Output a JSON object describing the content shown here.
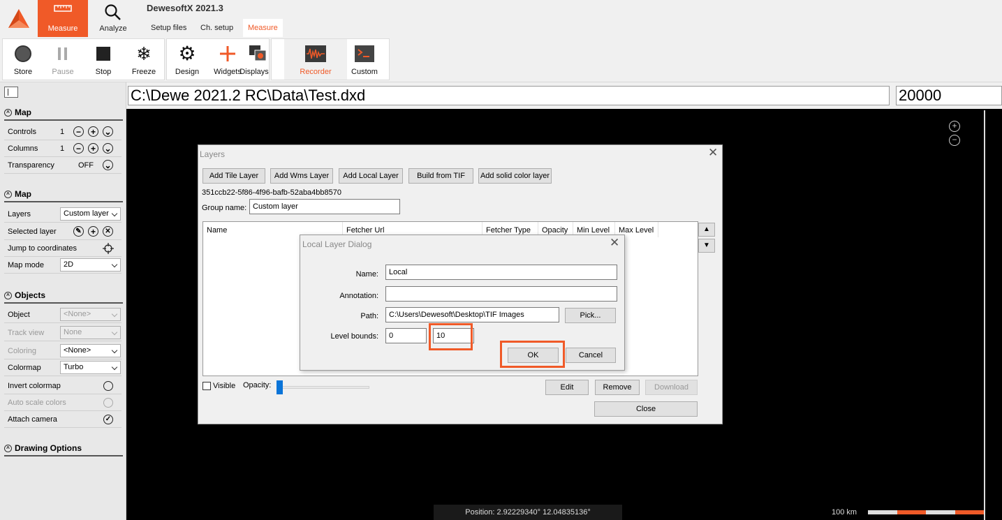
{
  "app": {
    "title": "DewesoftX 2021.3",
    "modes": [
      {
        "label": "Measure",
        "icon": "ruler-icon"
      },
      {
        "label": "Analyze",
        "icon": "magnifier-icon"
      }
    ],
    "subtabs": [
      "Setup files",
      "Ch. setup",
      "Measure"
    ],
    "active_subtab": "Measure",
    "accent_color": "#f05a28"
  },
  "toolbar": {
    "store": "Store",
    "pause": "Pause",
    "stop": "Stop",
    "freeze": "Freeze",
    "design": "Design",
    "widgets": "Widgets",
    "displays": "Displays",
    "recorder": "Recorder",
    "custom": "Custom"
  },
  "top_fields": {
    "file_path": "C:\\Dewe 2021.2 RC\\Data\\Test.dxd",
    "count": "20000"
  },
  "sidebar": {
    "section_map1": {
      "title": "Map",
      "controls_label": "Controls",
      "controls_value": "1",
      "columns_label": "Columns",
      "columns_value": "1",
      "transparency_label": "Transparency",
      "transparency_value": "OFF"
    },
    "section_map2": {
      "title": "Map",
      "layers_label": "Layers",
      "layers_value": "Custom layer",
      "selected_layer_label": "Selected layer",
      "jump_label": "Jump to coordinates",
      "map_mode_label": "Map mode",
      "map_mode_value": "2D"
    },
    "section_objects": {
      "title": "Objects",
      "object_label": "Object",
      "object_value": "<None>",
      "track_view_label": "Track view",
      "track_view_value": "None",
      "coloring_label": "Coloring",
      "coloring_value": "<None>",
      "colormap_label": "Colormap",
      "colormap_value": "Turbo",
      "invert_label": "Invert colormap",
      "auto_scale_label": "Auto scale colors",
      "attach_camera_label": "Attach camera"
    },
    "section_drawing": {
      "title": "Drawing Options"
    }
  },
  "map_view": {
    "position_text": "Position: 2.92229340° 12.04835136°",
    "scale_label": "100 km"
  },
  "layers_dialog": {
    "title": "Layers",
    "buttons": {
      "add_tile": "Add Tile Layer",
      "add_wms": "Add Wms Layer",
      "add_local": "Add Local Layer",
      "build_tif": "Build from TIF",
      "add_solid": "Add solid color layer"
    },
    "layer_id": "351ccb22-5f86-4f96-bafb-52aba4bb8570",
    "group_name_label": "Group name:",
    "group_name_value": "Custom layer",
    "columns": {
      "name": "Name",
      "fetcher_url": "Fetcher Url",
      "fetcher_type": "Fetcher Type",
      "opacity": "Opacity",
      "min_level": "Min Level",
      "max_level": "Max Level"
    },
    "visible_label": "Visible",
    "opacity_label": "Opacity:",
    "opacity_value": 0,
    "edit": "Edit",
    "remove": "Remove",
    "download": "Download",
    "close": "Close"
  },
  "local_dialog": {
    "title": "Local Layer Dialog",
    "name_label": "Name:",
    "name_value": "Local",
    "annotation_label": "Annotation:",
    "annotation_value": "",
    "path_label": "Path:",
    "path_value": "C:\\Users\\Dewesoft\\Desktop\\TIF Images",
    "pick": "Pick...",
    "level_bounds_label": "Level bounds:",
    "level_min": "0",
    "level_max": "10",
    "ok": "OK",
    "cancel": "Cancel"
  }
}
